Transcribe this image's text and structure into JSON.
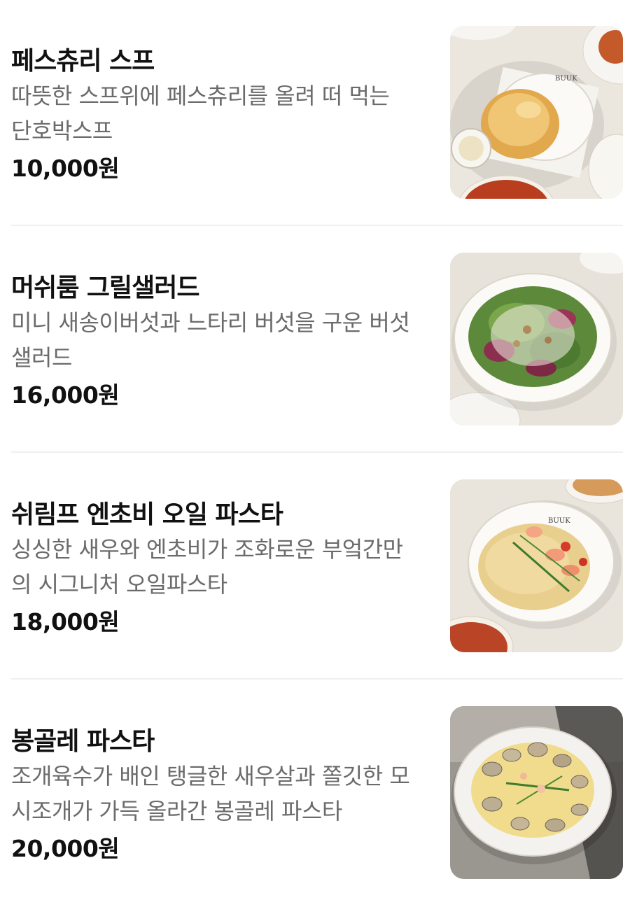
{
  "menu": {
    "items": [
      {
        "name": "페스츄리 스프",
        "description_line1": "따뜻한 스프위에 페스츄리를 올려 떠 먹는",
        "description_line2": "단호박스프",
        "price": "10,000원",
        "image_alt": "pastry soup photo",
        "image_lettering": "BUUK"
      },
      {
        "name": "머쉬룸 그릴샐러드",
        "description_line1": "미니 새송이버섯과 느타리 버섯을 구운 버섯",
        "description_line2": "샐러드",
        "price": "16,000원",
        "image_alt": "mushroom grill salad photo"
      },
      {
        "name": "쉬림프 엔초비 오일 파스타",
        "description_line1": "싱싱한 새우와 엔초비가 조화로운 부엌간만",
        "description_line2": "의 시그니처 오일파스타",
        "price": "18,000원",
        "image_alt": "shrimp anchovy oil pasta photo",
        "image_lettering": "BUUK"
      },
      {
        "name": "봉골레 파스타",
        "description_line1": "조개육수가 배인 탱글한 새우살과 쫄깃한 모",
        "description_line2": "시조개가 가득 올라간 봉골레 파스타",
        "price": "20,000원",
        "image_alt": "vongole pasta photo"
      }
    ]
  },
  "colors": {
    "title": "#111111",
    "description": "#6b6b6b",
    "divider": "#f0f0f0",
    "background": "#ffffff"
  }
}
